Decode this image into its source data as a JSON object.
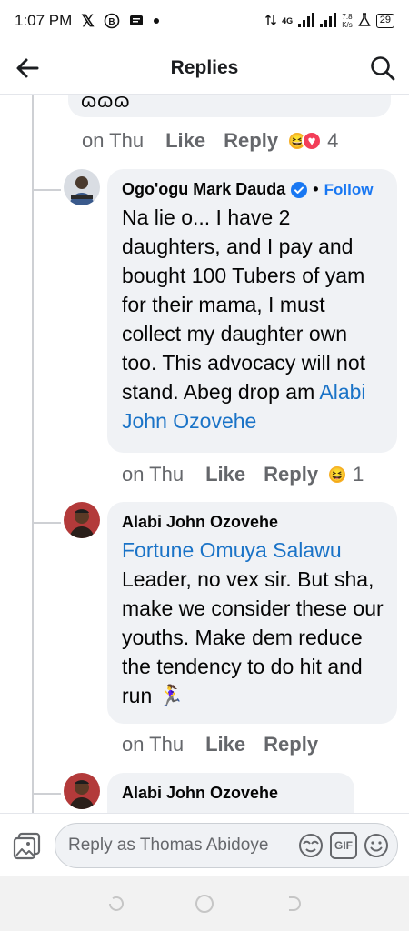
{
  "status": {
    "time": "1:07 PM",
    "network": "4G",
    "speed_value": "7.8",
    "speed_unit": "K/s",
    "battery": "29"
  },
  "header": {
    "title": "Replies"
  },
  "previous_comment": {
    "text_fragment": "ɷɷɷ",
    "time": "on Thu",
    "like": "Like",
    "reply": "Reply",
    "reaction_count": "4"
  },
  "comments": [
    {
      "author": "Ogo'ogu Mark Dauda",
      "follow_separator": "•",
      "follow": "Follow",
      "text": "Na lie o... I have 2 daughters, and I pay and bought 100 Tubers of yam for their mama, I must collect my daughter own too. This advocacy will not stand. Abeg drop am ",
      "mention": "Alabi John Ozovehe",
      "time": "on Thu",
      "like": "Like",
      "reply": "Reply",
      "reaction_count": "1"
    },
    {
      "author": "Alabi John Ozovehe",
      "mention": "Fortune Omuya Salawu",
      "text": "Leader, no vex sir. But sha, make we consider these our youths. Make dem reduce the tendency to do hit and run 🏃‍♀️",
      "time": "on Thu",
      "like": "Like",
      "reply": "Reply"
    },
    {
      "author": "Alabi John Ozovehe"
    }
  ],
  "composer": {
    "placeholder": "Reply as Thomas Abidoye",
    "gif_label": "GIF"
  },
  "colors": {
    "link": "#1877f2",
    "mention": "#1a73c7",
    "bubble": "#f0f2f5",
    "meta": "#65676b"
  }
}
